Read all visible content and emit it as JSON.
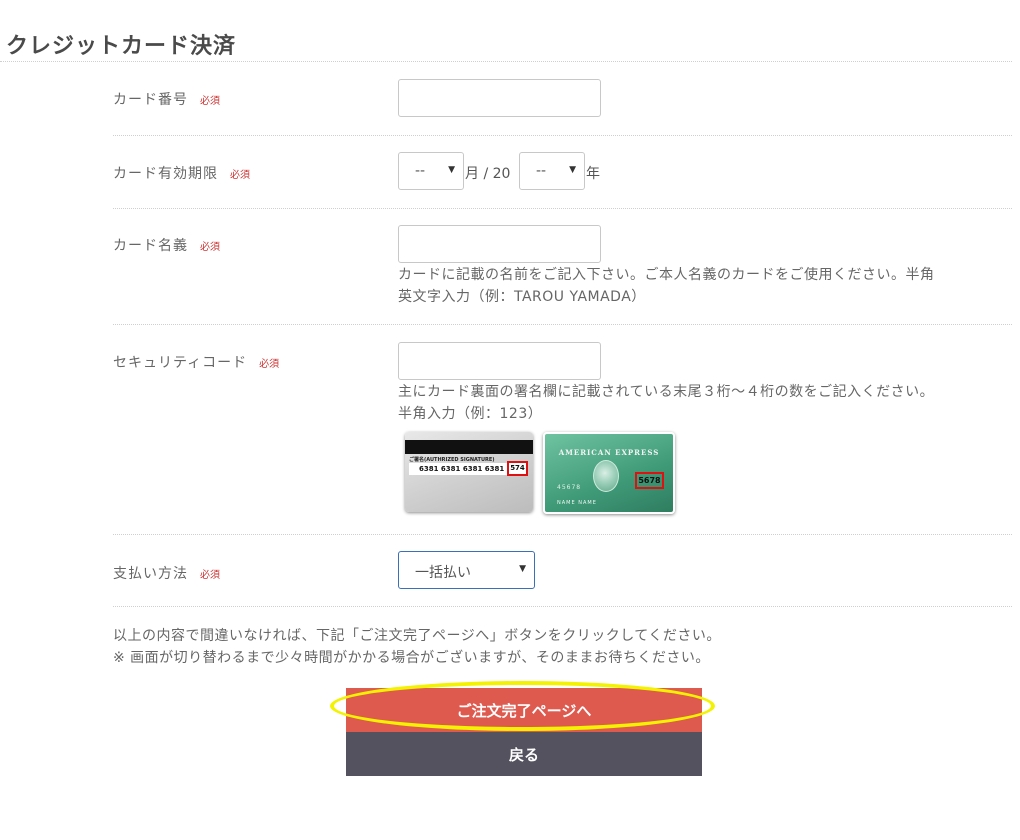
{
  "page": {
    "title": "クレジットカード決済",
    "required_badge": "必須"
  },
  "card_number": {
    "label": "カード番号"
  },
  "card_expiry": {
    "label": "カード有効期限",
    "month_value": "--",
    "month_suffix": "月 / 20",
    "year_value": "--",
    "year_suffix": "年"
  },
  "card_holder": {
    "label": "カード名義",
    "help_line1": "カードに記載の名前をご記入下さい。ご本人名義のカードをご使用ください。半角",
    "help_line2": "英文字入力（例：TAROU YAMADA）"
  },
  "security_code": {
    "label": "セキュリティコード",
    "help_line1": "主にカード裏面の署名欄に記載されている末尾３桁～４桁の数をご記入ください。",
    "help_line2": "半角入力（例：123）",
    "card_back": {
      "signature_label": "ご署名(AUTHRIZED SIGNATURE)",
      "number": "6381 6381 6381 6381",
      "code": "574"
    },
    "card_amex": {
      "brand": "AMERICAN EXPRESS",
      "number_fragment": "45678",
      "holder": "NAME NAME",
      "code": "5678"
    }
  },
  "payment_method": {
    "label": "支払い方法",
    "selected": "一括払い"
  },
  "notice": {
    "line1": "以上の内容で間違いなければ、下記「ご注文完了ページへ」ボタンをクリックしてください。",
    "line2": "※ 画面が切り替わるまで少々時間がかかる場合がございますが、そのままお待ちください。"
  },
  "buttons": {
    "submit": "ご注文完了ページへ",
    "back": "戻る"
  },
  "colors": {
    "required": "#cc3333",
    "submit_button": "#de5a4f",
    "back_button": "#55525f",
    "highlight": "#f3f200"
  },
  "icons": {
    "select_arrow": "triangle-down"
  }
}
